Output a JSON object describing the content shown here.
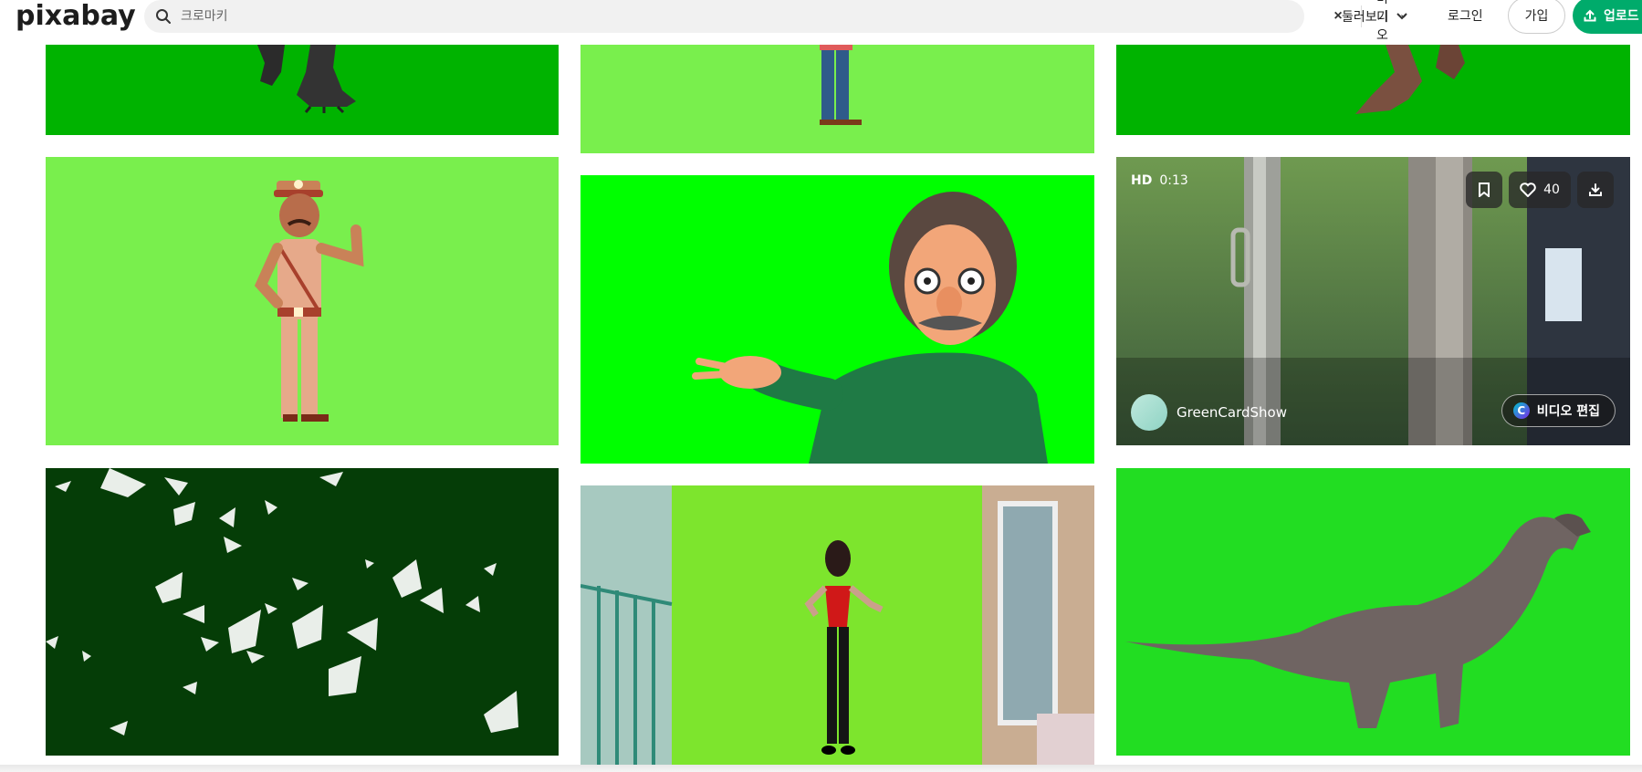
{
  "header": {
    "logo_text": "pixabay",
    "search_placeholder": "크로마키",
    "search_value": "",
    "clear_symbol": "×",
    "media_type_label": "비디오",
    "explore_label": "둘러보기",
    "login_label": "로그인",
    "join_label": "가입",
    "upload_label": "업로드"
  },
  "tiles": [
    {
      "id": "gorilla-feet",
      "bg": "#00b300"
    },
    {
      "id": "man-legs",
      "bg": "#79ef4d"
    },
    {
      "id": "dino-foot",
      "bg": "#00b300"
    },
    {
      "id": "police-cartoon",
      "bg": "#79ef4d"
    },
    {
      "id": "grandpa-cartoon",
      "bg": "#00ff00"
    },
    {
      "id": "window-frame",
      "bg": "#5a8a3a"
    },
    {
      "id": "doves",
      "bg": "#053d07"
    },
    {
      "id": "dancer",
      "bg": "#7de52d"
    },
    {
      "id": "brachiosaurus",
      "bg": "#22dd22"
    }
  ],
  "hover_tile": {
    "quality": "HD",
    "duration": "0:13",
    "likes": "40",
    "author": "GreenCardShow",
    "edit_label": "비디오 편집",
    "canva_letter": "C"
  },
  "icons": [
    "search-icon",
    "chevron-down-icon",
    "upload-icon",
    "bookmark-icon",
    "heart-icon",
    "download-icon"
  ]
}
